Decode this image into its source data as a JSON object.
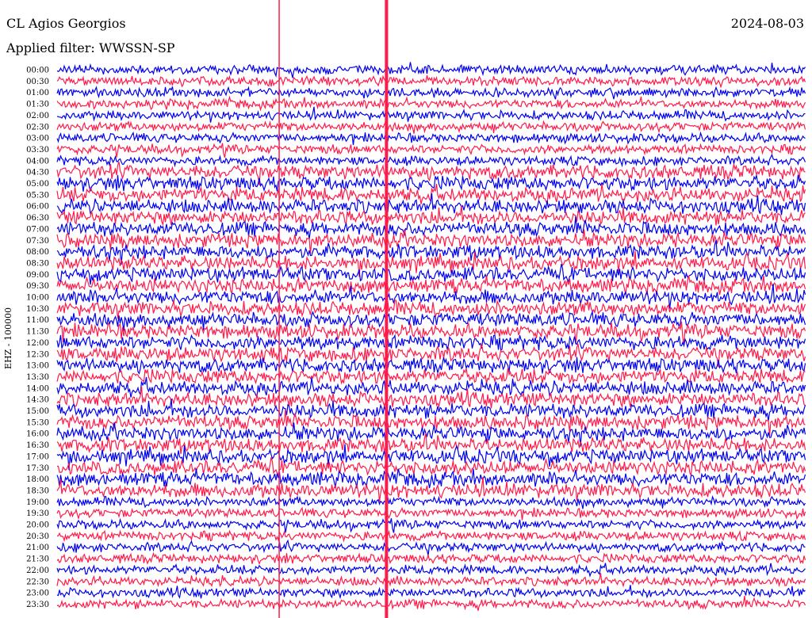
{
  "header": {
    "station": "CL Agios Georgios",
    "filter": "Applied filter: WWSSN-SP",
    "date": "2024-08-03"
  },
  "chart_data": {
    "type": "line",
    "title": "CL Agios Georgios",
    "subtitle": "Applied filter: WWSSN-SP",
    "ylabel": "EHZ - 100000",
    "date": "2024-08-03",
    "row_labels": [
      "00:00",
      "00:30",
      "01:00",
      "01:30",
      "02:00",
      "02:30",
      "03:00",
      "03:30",
      "04:00",
      "04:30",
      "05:00",
      "05:30",
      "06:00",
      "06:30",
      "07:00",
      "07:30",
      "08:00",
      "08:30",
      "09:00",
      "09:30",
      "10:00",
      "10:30",
      "11:00",
      "11:30",
      "12:00",
      "12:30",
      "13:00",
      "13:30",
      "14:00",
      "14:30",
      "15:00",
      "15:30",
      "16:00",
      "16:30",
      "17:00",
      "17:30",
      "18:00",
      "18:30",
      "19:00",
      "19:30",
      "20:00",
      "20:30",
      "21:00",
      "21:30",
      "22:00",
      "22:30",
      "23:00",
      "23:30"
    ],
    "series_colors": [
      "#0000ee",
      "#ff1a4a"
    ],
    "events": [
      {
        "minute": 8.9,
        "note": "vertical spike"
      },
      {
        "minute": 13.2,
        "note": "vertical spike"
      }
    ],
    "grid": false
  }
}
